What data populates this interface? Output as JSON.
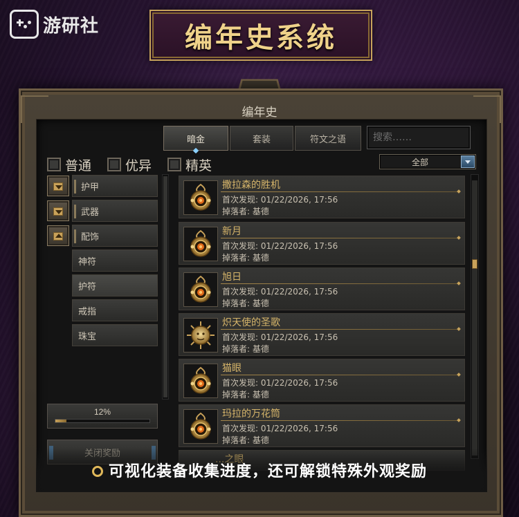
{
  "watermark": {
    "text": "游研社"
  },
  "banner": {
    "title": "编年史系统"
  },
  "window": {
    "title": "编年史"
  },
  "tabs": [
    {
      "label": "暗金",
      "active": true
    },
    {
      "label": "套装",
      "active": false
    },
    {
      "label": "符文之语",
      "active": false
    }
  ],
  "search": {
    "placeholder": "搜索……"
  },
  "filters": [
    {
      "label": "普通",
      "checked": false
    },
    {
      "label": "优异",
      "checked": false
    },
    {
      "label": "精英",
      "checked": false
    }
  ],
  "dropdown": {
    "value": "全部"
  },
  "sidebar": {
    "categories": [
      {
        "label": "护甲",
        "expanded": false
      },
      {
        "label": "武器",
        "expanded": false
      },
      {
        "label": "配饰",
        "expanded": true
      }
    ],
    "subitems": [
      {
        "label": "神符",
        "selected": false
      },
      {
        "label": "护符",
        "selected": true
      },
      {
        "label": "戒指",
        "selected": false
      },
      {
        "label": "珠宝",
        "selected": false
      }
    ]
  },
  "progress": {
    "label": "12%",
    "value": 0.12
  },
  "reward_button": {
    "label": "关闭奖励"
  },
  "items": [
    {
      "name": "撒拉森的胜机",
      "date": "首次发现: 01/22/2026, 17:56",
      "dropper": "掉落者: 基德",
      "icon": "amulet-icon"
    },
    {
      "name": "新月",
      "date": "首次发现: 01/22/2026, 17:56",
      "dropper": "掉落者: 基德",
      "icon": "amulet-icon"
    },
    {
      "name": "旭日",
      "date": "首次发现: 01/22/2026, 17:56",
      "dropper": "掉落者: 基德",
      "icon": "amulet-icon"
    },
    {
      "name": "炽天使的圣歌",
      "date": "首次发现: 01/22/2026, 17:56",
      "dropper": "掉落者: 基德",
      "icon": "sun-amulet-icon"
    },
    {
      "name": "猫眼",
      "date": "首次发现: 01/22/2026, 17:56",
      "dropper": "掉落者: 基德",
      "icon": "amulet-icon"
    },
    {
      "name": "玛拉的万花筒",
      "date": "首次发现: 01/22/2026, 17:56",
      "dropper": "掉落者: 基德",
      "icon": "amulet-icon"
    }
  ],
  "partial_item": {
    "name": "...之眼"
  },
  "caption": {
    "text": "可视化装备收集进度，还可解锁特殊外观奖励"
  },
  "colors": {
    "gold": "#d6b56a",
    "accent_blue": "#8ad0ff",
    "background": "#24122d"
  }
}
